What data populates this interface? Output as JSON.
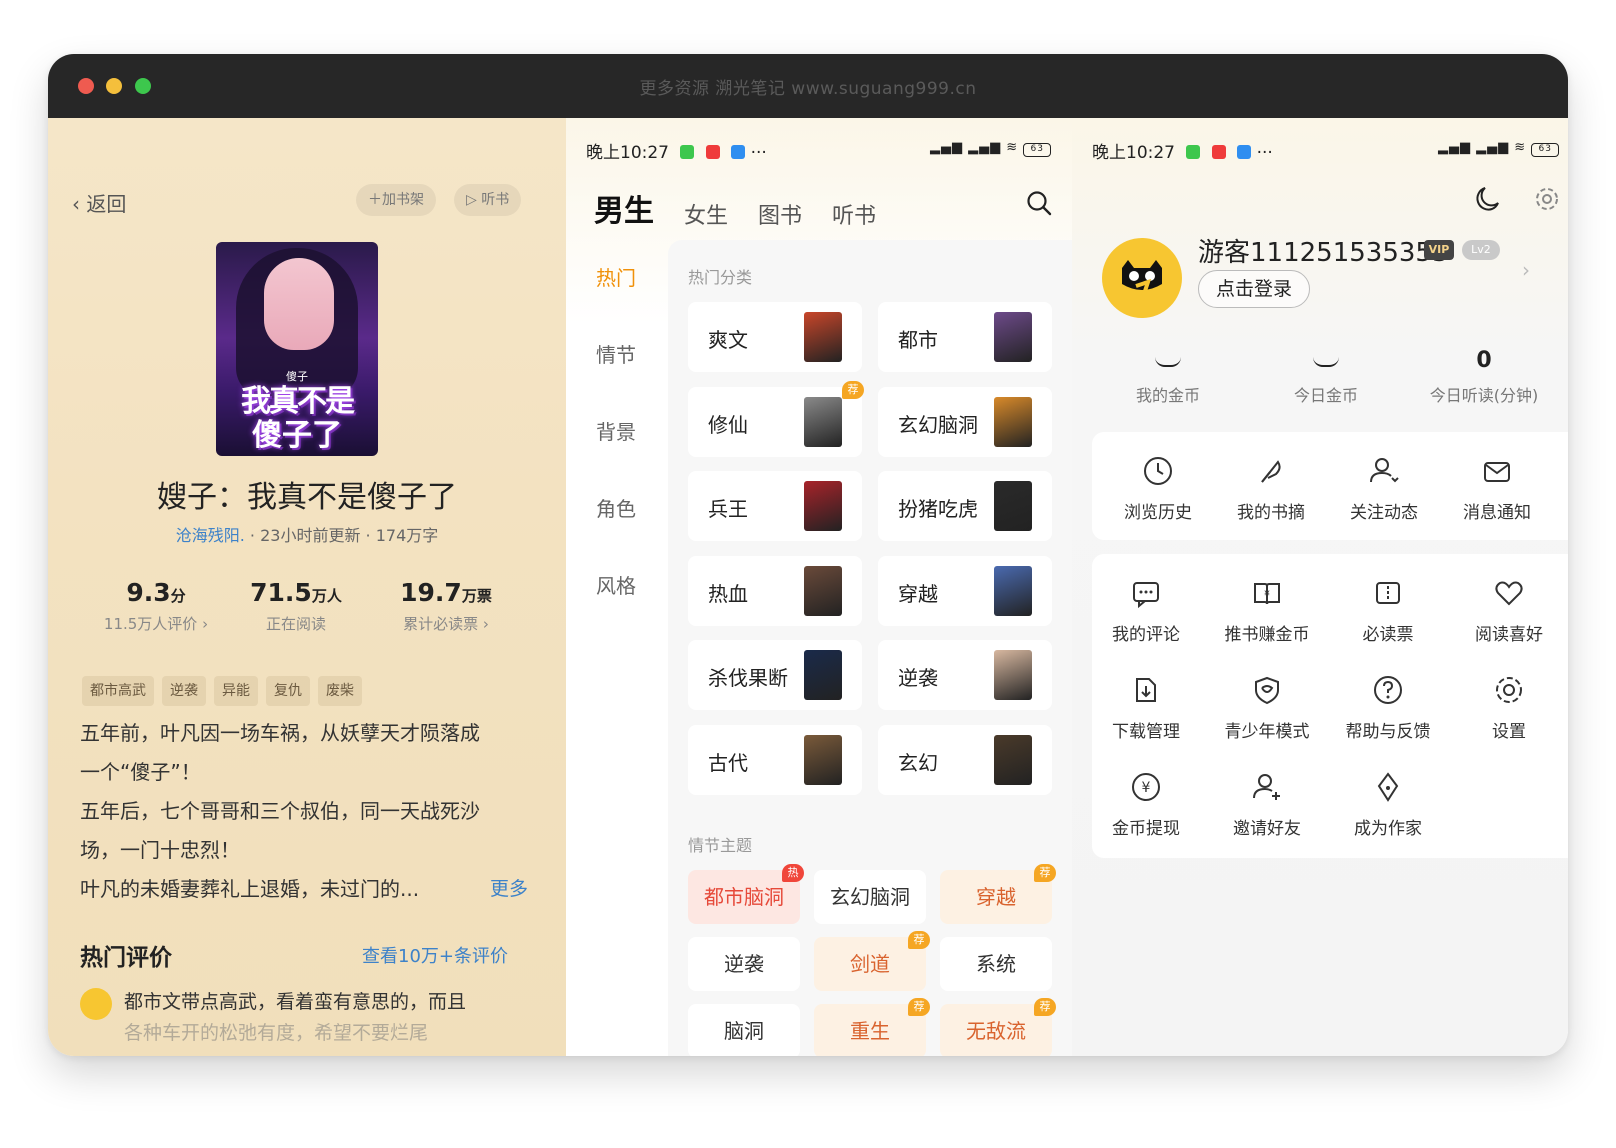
{
  "window": {
    "title": "更多资源  溯光笔记  www.suguang999.cn"
  },
  "detail": {
    "back": "返回",
    "add_shelf": "加书架",
    "listen": "听书",
    "cover_small": "傻子",
    "cover_line1": "我真不是",
    "cover_line2": "傻子了",
    "title": "嫂子：我真不是傻子了",
    "author": "沧海残阳.",
    "updated": "23小时前更新",
    "words": "174万字",
    "stats": [
      {
        "value": "9.3",
        "unit": "分",
        "label": "11.5万人评价 ›"
      },
      {
        "value": "71.5",
        "unit": "万人",
        "label": "正在阅读"
      },
      {
        "value": "19.7",
        "unit": "万票",
        "label": "累计必读票 ›"
      }
    ],
    "tags": [
      "都市高武",
      "逆袭",
      "异能",
      "复仇",
      "废柴"
    ],
    "desc_lines": [
      "五年前，叶凡因一场车祸，从妖孽天才陨落成",
      "一个“傻子”！",
      "五年后，七个哥哥和三个叔伯，同一天战死沙",
      "场，一门十忠烈！",
      "叶凡的未婚妻葬礼上退婚，未过门的..."
    ],
    "more": "更多",
    "hot_title": "热门评价",
    "hot_link": "查看10万+条评价",
    "comment": "都市文带点高武，看着蛮有意思的，而且",
    "comment2": "各种车开的松弛有度，希望不要烂尾"
  },
  "status": {
    "time": "晚上10:27",
    "dots": "···",
    "battery": "63"
  },
  "category": {
    "tabs": [
      "男生",
      "女生",
      "图书",
      "听书"
    ],
    "side": [
      "热门",
      "情节",
      "背景",
      "角色",
      "风格"
    ],
    "section1": "热门分类",
    "items": [
      {
        "name": "爽文",
        "color": "#c9462a"
      },
      {
        "name": "都市",
        "color": "#6d4a8a"
      },
      {
        "name": "修仙",
        "color": "#8a8a8a",
        "badge": "荐"
      },
      {
        "name": "玄幻脑洞",
        "color": "#d98a2a"
      },
      {
        "name": "兵王",
        "color": "#a8232a"
      },
      {
        "name": "扮猪吃虎",
        "color": "#2a2a2a"
      },
      {
        "name": "热血",
        "color": "#6a4a3a"
      },
      {
        "name": "穿越",
        "color": "#4a6ab0"
      },
      {
        "name": "杀伐果断",
        "color": "#1a2a4a"
      },
      {
        "name": "逆袭",
        "color": "#d8b8a0"
      },
      {
        "name": "古代",
        "color": "#7a5a3a"
      },
      {
        "name": "玄幻",
        "color": "#4a3a2a"
      }
    ],
    "section2": "情节主题",
    "themes": [
      {
        "name": "都市脑洞",
        "style": "hot",
        "badge": "热"
      },
      {
        "name": "玄幻脑洞",
        "style": ""
      },
      {
        "name": "穿越",
        "style": "warm",
        "badge": "荐"
      },
      {
        "name": "逆袭",
        "style": ""
      },
      {
        "name": "剑道",
        "style": "warm",
        "badge": "荐"
      },
      {
        "name": "系统",
        "style": ""
      },
      {
        "name": "脑洞",
        "style": ""
      },
      {
        "name": "重生",
        "style": "warm",
        "badge": "荐"
      },
      {
        "name": "无敌流",
        "style": "warm",
        "badge": "荐"
      }
    ]
  },
  "profile": {
    "username": "游客111251535353",
    "vip": "VIP",
    "level": "Lv2",
    "login": "点击登录",
    "coins": [
      {
        "value": "",
        "label": "我的金币"
      },
      {
        "value": "",
        "label": "今日金币"
      },
      {
        "value": "0",
        "label": "今日听读(分钟)"
      }
    ],
    "quick": [
      {
        "label": "浏览历史",
        "icon": "clock-icon"
      },
      {
        "label": "我的书摘",
        "icon": "feather-icon"
      },
      {
        "label": "关注动态",
        "icon": "user-heart-icon"
      },
      {
        "label": "消息通知",
        "icon": "mail-icon"
      }
    ],
    "services": [
      {
        "label": "我的评论",
        "icon": "comment-icon"
      },
      {
        "label": "推书赚金币",
        "icon": "book-coin-icon"
      },
      {
        "label": "必读票",
        "icon": "ticket-icon"
      },
      {
        "label": "阅读喜好",
        "icon": "heart-icon"
      },
      {
        "label": "下载管理",
        "icon": "download-icon"
      },
      {
        "label": "青少年模式",
        "icon": "shield-icon"
      },
      {
        "label": "帮助与反馈",
        "icon": "help-icon"
      },
      {
        "label": "设置",
        "icon": "gear-icon"
      },
      {
        "label": "金币提现",
        "icon": "yen-icon"
      },
      {
        "label": "邀请好友",
        "icon": "add-user-icon"
      },
      {
        "label": "成为作家",
        "icon": "pen-icon"
      }
    ]
  }
}
